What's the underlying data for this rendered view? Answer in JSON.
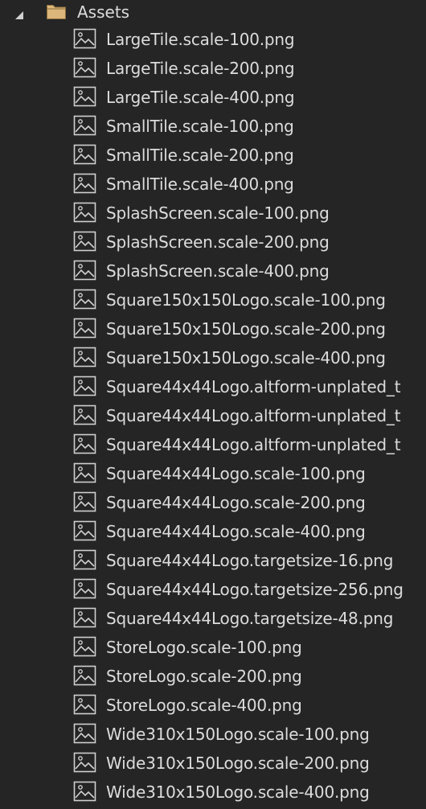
{
  "folder": {
    "label": "Assets",
    "expanded": true,
    "icon": "folder-icon",
    "accent_color": "#dcb67a"
  },
  "file_icon": "image-file-icon",
  "files": [
    "LargeTile.scale-100.png",
    "LargeTile.scale-200.png",
    "LargeTile.scale-400.png",
    "SmallTile.scale-100.png",
    "SmallTile.scale-200.png",
    "SmallTile.scale-400.png",
    "SplashScreen.scale-100.png",
    "SplashScreen.scale-200.png",
    "SplashScreen.scale-400.png",
    "Square150x150Logo.scale-100.png",
    "Square150x150Logo.scale-200.png",
    "Square150x150Logo.scale-400.png",
    "Square44x44Logo.altform-unplated_t",
    "Square44x44Logo.altform-unplated_t",
    "Square44x44Logo.altform-unplated_t",
    "Square44x44Logo.scale-100.png",
    "Square44x44Logo.scale-200.png",
    "Square44x44Logo.scale-400.png",
    "Square44x44Logo.targetsize-16.png",
    "Square44x44Logo.targetsize-256.png",
    "Square44x44Logo.targetsize-48.png",
    "StoreLogo.scale-100.png",
    "StoreLogo.scale-200.png",
    "StoreLogo.scale-400.png",
    "Wide310x150Logo.scale-100.png",
    "Wide310x150Logo.scale-200.png",
    "Wide310x150Logo.scale-400.png"
  ]
}
